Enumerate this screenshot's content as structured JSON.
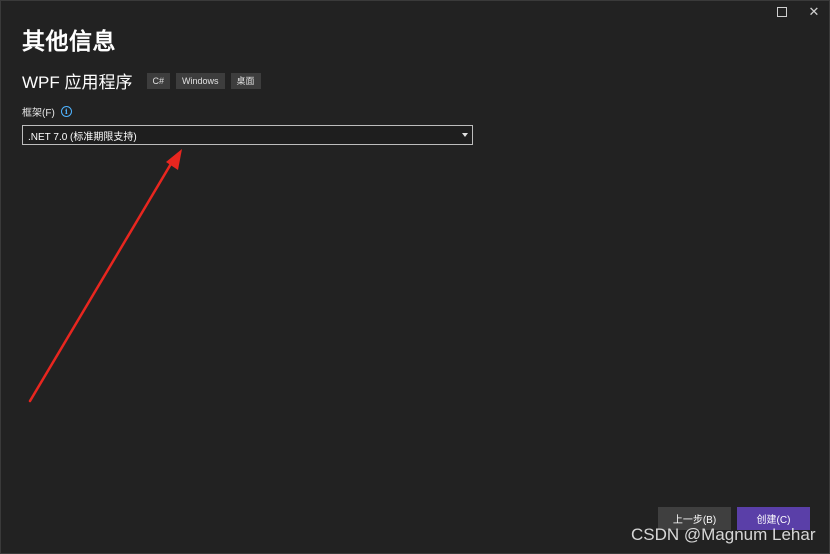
{
  "window": {
    "maximize_icon": "maximize-icon",
    "close_icon": "close-icon",
    "close_glyph": "✕"
  },
  "page": {
    "title": "其他信息"
  },
  "project": {
    "type_name": "WPF 应用程序",
    "tags": [
      "C#",
      "Windows",
      "桌面"
    ]
  },
  "framework": {
    "label": "框架(F)",
    "info_icon": "info-icon",
    "info_glyph": "i",
    "selected_value": ".NET 7.0 (标准期限支持)"
  },
  "footer": {
    "back_label": "上一步(B)",
    "create_label": "创建(C)"
  },
  "watermark": {
    "text": "CSDN @Magnum Lehar"
  },
  "colors": {
    "background": "#222222",
    "accent": "#5a3fa8",
    "info": "#4fb3ff",
    "annotation_arrow": "#e8261f"
  }
}
